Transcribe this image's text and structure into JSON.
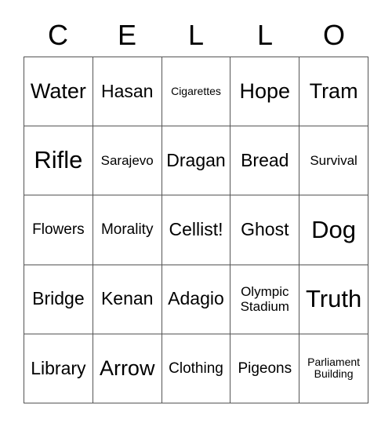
{
  "header": {
    "letters": [
      "C",
      "E",
      "L",
      "L",
      "O"
    ]
  },
  "colors": {
    "grid_line": "#555555",
    "text": "#000000",
    "background": "#ffffff"
  },
  "grid": {
    "columns": 5,
    "rows": 5,
    "cells": [
      [
        {
          "label": "Water",
          "size": "sz-lg"
        },
        {
          "label": "Hasan",
          "size": "sz-md"
        },
        {
          "label": "Cigarettes",
          "size": "sz-xxs"
        },
        {
          "label": "Hope",
          "size": "sz-lg"
        },
        {
          "label": "Tram",
          "size": "sz-lg"
        }
      ],
      [
        {
          "label": "Rifle",
          "size": "sz-xl"
        },
        {
          "label": "Sarajevo",
          "size": "sz-xs"
        },
        {
          "label": "Dragan",
          "size": "sz-md"
        },
        {
          "label": "Bread",
          "size": "sz-md"
        },
        {
          "label": "Survival",
          "size": "sz-xs"
        }
      ],
      [
        {
          "label": "Flowers",
          "size": "sz-sm"
        },
        {
          "label": "Morality",
          "size": "sz-sm"
        },
        {
          "label": "Cellist!",
          "size": "sz-md"
        },
        {
          "label": "Ghost",
          "size": "sz-md"
        },
        {
          "label": "Dog",
          "size": "sz-xl"
        }
      ],
      [
        {
          "label": "Bridge",
          "size": "sz-md"
        },
        {
          "label": "Kenan",
          "size": "sz-md"
        },
        {
          "label": "Adagio",
          "size": "sz-md"
        },
        {
          "label": "Olympic Stadium",
          "size": "sz-xs"
        },
        {
          "label": "Truth",
          "size": "sz-xl"
        }
      ],
      [
        {
          "label": "Library",
          "size": "sz-md"
        },
        {
          "label": "Arrow",
          "size": "sz-lg"
        },
        {
          "label": "Clothing",
          "size": "sz-sm"
        },
        {
          "label": "Pigeons",
          "size": "sz-sm"
        },
        {
          "label": "Parliament Building",
          "size": "sz-xxs"
        }
      ]
    ]
  }
}
